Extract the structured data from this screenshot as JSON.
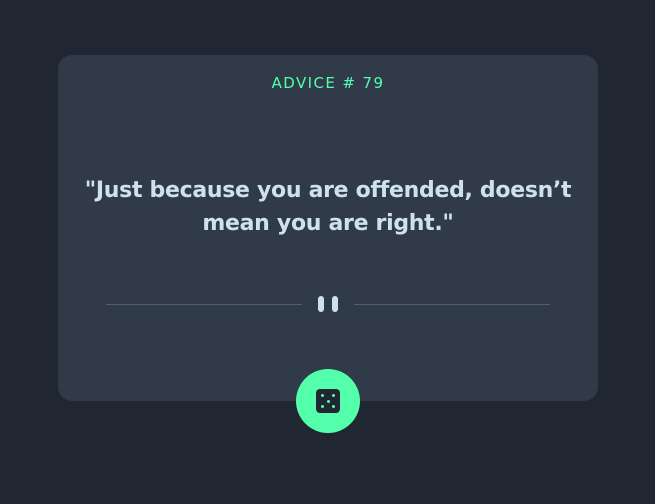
{
  "advice": {
    "id_label": "ADVICE # 79",
    "quote": "\"Just because you are offended, doesn’t mean you are right.\""
  },
  "icons": {
    "divider": "pause-icon",
    "button": "dice-icon"
  },
  "colors": {
    "background": "#202632",
    "card": "#313A48",
    "accent": "#53FFAA",
    "text": "#CEE3E9",
    "divider": "#4F5D74"
  }
}
